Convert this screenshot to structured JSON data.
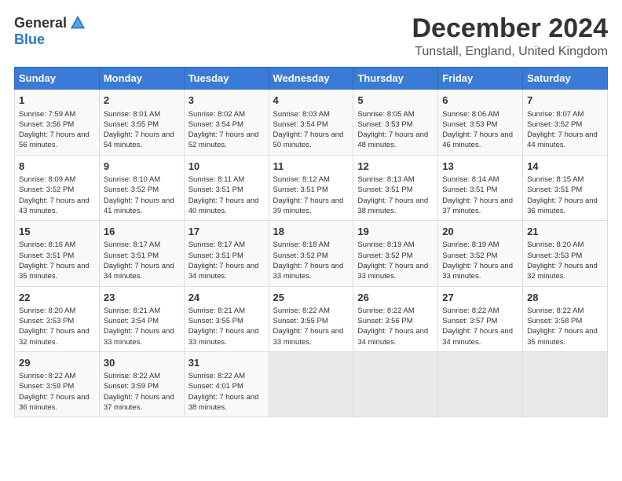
{
  "logo": {
    "general": "General",
    "blue": "Blue"
  },
  "title": {
    "month": "December 2024",
    "location": "Tunstall, England, United Kingdom"
  },
  "headers": [
    "Sunday",
    "Monday",
    "Tuesday",
    "Wednesday",
    "Thursday",
    "Friday",
    "Saturday"
  ],
  "weeks": [
    [
      {
        "day": "1",
        "sunrise": "Sunrise: 7:59 AM",
        "sunset": "Sunset: 3:56 PM",
        "daylight": "Daylight: 7 hours and 56 minutes."
      },
      {
        "day": "2",
        "sunrise": "Sunrise: 8:01 AM",
        "sunset": "Sunset: 3:55 PM",
        "daylight": "Daylight: 7 hours and 54 minutes."
      },
      {
        "day": "3",
        "sunrise": "Sunrise: 8:02 AM",
        "sunset": "Sunset: 3:54 PM",
        "daylight": "Daylight: 7 hours and 52 minutes."
      },
      {
        "day": "4",
        "sunrise": "Sunrise: 8:03 AM",
        "sunset": "Sunset: 3:54 PM",
        "daylight": "Daylight: 7 hours and 50 minutes."
      },
      {
        "day": "5",
        "sunrise": "Sunrise: 8:05 AM",
        "sunset": "Sunset: 3:53 PM",
        "daylight": "Daylight: 7 hours and 48 minutes."
      },
      {
        "day": "6",
        "sunrise": "Sunrise: 8:06 AM",
        "sunset": "Sunset: 3:53 PM",
        "daylight": "Daylight: 7 hours and 46 minutes."
      },
      {
        "day": "7",
        "sunrise": "Sunrise: 8:07 AM",
        "sunset": "Sunset: 3:52 PM",
        "daylight": "Daylight: 7 hours and 44 minutes."
      }
    ],
    [
      {
        "day": "8",
        "sunrise": "Sunrise: 8:09 AM",
        "sunset": "Sunset: 3:52 PM",
        "daylight": "Daylight: 7 hours and 43 minutes."
      },
      {
        "day": "9",
        "sunrise": "Sunrise: 8:10 AM",
        "sunset": "Sunset: 3:52 PM",
        "daylight": "Daylight: 7 hours and 41 minutes."
      },
      {
        "day": "10",
        "sunrise": "Sunrise: 8:11 AM",
        "sunset": "Sunset: 3:51 PM",
        "daylight": "Daylight: 7 hours and 40 minutes."
      },
      {
        "day": "11",
        "sunrise": "Sunrise: 8:12 AM",
        "sunset": "Sunset: 3:51 PM",
        "daylight": "Daylight: 7 hours and 39 minutes."
      },
      {
        "day": "12",
        "sunrise": "Sunrise: 8:13 AM",
        "sunset": "Sunset: 3:51 PM",
        "daylight": "Daylight: 7 hours and 38 minutes."
      },
      {
        "day": "13",
        "sunrise": "Sunrise: 8:14 AM",
        "sunset": "Sunset: 3:51 PM",
        "daylight": "Daylight: 7 hours and 37 minutes."
      },
      {
        "day": "14",
        "sunrise": "Sunrise: 8:15 AM",
        "sunset": "Sunset: 3:51 PM",
        "daylight": "Daylight: 7 hours and 36 minutes."
      }
    ],
    [
      {
        "day": "15",
        "sunrise": "Sunrise: 8:16 AM",
        "sunset": "Sunset: 3:51 PM",
        "daylight": "Daylight: 7 hours and 35 minutes."
      },
      {
        "day": "16",
        "sunrise": "Sunrise: 8:17 AM",
        "sunset": "Sunset: 3:51 PM",
        "daylight": "Daylight: 7 hours and 34 minutes."
      },
      {
        "day": "17",
        "sunrise": "Sunrise: 8:17 AM",
        "sunset": "Sunset: 3:51 PM",
        "daylight": "Daylight: 7 hours and 34 minutes."
      },
      {
        "day": "18",
        "sunrise": "Sunrise: 8:18 AM",
        "sunset": "Sunset: 3:52 PM",
        "daylight": "Daylight: 7 hours and 33 minutes."
      },
      {
        "day": "19",
        "sunrise": "Sunrise: 8:19 AM",
        "sunset": "Sunset: 3:52 PM",
        "daylight": "Daylight: 7 hours and 33 minutes."
      },
      {
        "day": "20",
        "sunrise": "Sunrise: 8:19 AM",
        "sunset": "Sunset: 3:52 PM",
        "daylight": "Daylight: 7 hours and 33 minutes."
      },
      {
        "day": "21",
        "sunrise": "Sunrise: 8:20 AM",
        "sunset": "Sunset: 3:53 PM",
        "daylight": "Daylight: 7 hours and 32 minutes."
      }
    ],
    [
      {
        "day": "22",
        "sunrise": "Sunrise: 8:20 AM",
        "sunset": "Sunset: 3:53 PM",
        "daylight": "Daylight: 7 hours and 32 minutes."
      },
      {
        "day": "23",
        "sunrise": "Sunrise: 8:21 AM",
        "sunset": "Sunset: 3:54 PM",
        "daylight": "Daylight: 7 hours and 33 minutes."
      },
      {
        "day": "24",
        "sunrise": "Sunrise: 8:21 AM",
        "sunset": "Sunset: 3:55 PM",
        "daylight": "Daylight: 7 hours and 33 minutes."
      },
      {
        "day": "25",
        "sunrise": "Sunrise: 8:22 AM",
        "sunset": "Sunset: 3:55 PM",
        "daylight": "Daylight: 7 hours and 33 minutes."
      },
      {
        "day": "26",
        "sunrise": "Sunrise: 8:22 AM",
        "sunset": "Sunset: 3:56 PM",
        "daylight": "Daylight: 7 hours and 34 minutes."
      },
      {
        "day": "27",
        "sunrise": "Sunrise: 8:22 AM",
        "sunset": "Sunset: 3:57 PM",
        "daylight": "Daylight: 7 hours and 34 minutes."
      },
      {
        "day": "28",
        "sunrise": "Sunrise: 8:22 AM",
        "sunset": "Sunset: 3:58 PM",
        "daylight": "Daylight: 7 hours and 35 minutes."
      }
    ],
    [
      {
        "day": "29",
        "sunrise": "Sunrise: 8:22 AM",
        "sunset": "Sunset: 3:59 PM",
        "daylight": "Daylight: 7 hours and 36 minutes."
      },
      {
        "day": "30",
        "sunrise": "Sunrise: 8:22 AM",
        "sunset": "Sunset: 3:59 PM",
        "daylight": "Daylight: 7 hours and 37 minutes."
      },
      {
        "day": "31",
        "sunrise": "Sunrise: 8:22 AM",
        "sunset": "Sunset: 4:01 PM",
        "daylight": "Daylight: 7 hours and 38 minutes."
      },
      null,
      null,
      null,
      null
    ]
  ]
}
